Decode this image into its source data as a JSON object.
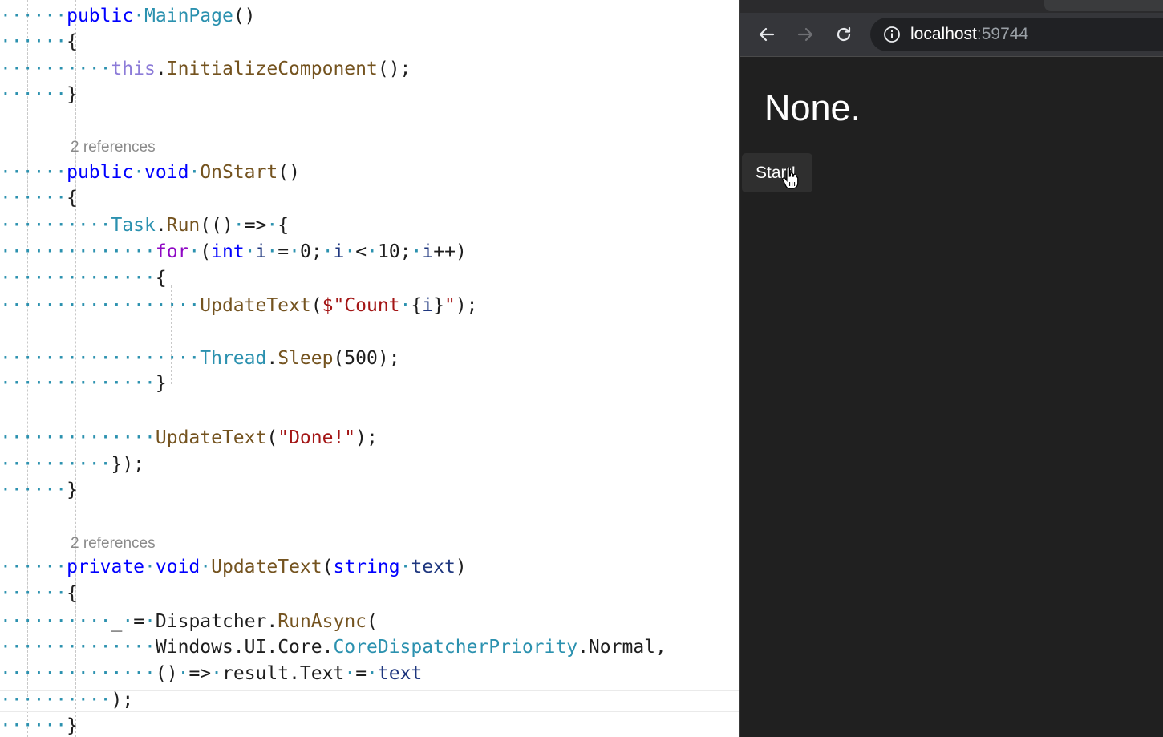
{
  "editor": {
    "lens_1": "2 references",
    "lens_2": "2 references",
    "lines": {
      "l01": "public MainPage()",
      "l02": "{",
      "l03": "this.InitializeComponent();",
      "l04": "}",
      "l05": "public void OnStart()",
      "l06": "{",
      "l07": "Task.Run(() => {",
      "l08": "for (int i = 0; i < 10; i++)",
      "l09": "{",
      "l10": "UpdateText($\"Count {i}\");",
      "l11": "Thread.Sleep(500);",
      "l12": "}",
      "l13": "UpdateText(\"Done!\");",
      "l14": "});",
      "l15": "}",
      "l16": "private void UpdateText(string text)",
      "l17": "{",
      "l18": "_ = Dispatcher.RunAsync(",
      "l19": "Windows.UI.Core.CoreDispatcherPriority.Normal,",
      "l20": "() => result.Text = text",
      "l21": ");",
      "l22": "}"
    }
  },
  "browser": {
    "url_host": "localhost",
    "url_port": ":59744",
    "result_text": "None.",
    "start_button_label": "Start!"
  },
  "colors": {
    "keyword": "#0000ff",
    "control": "#8f08c4",
    "type": "#2b91af",
    "method": "#74531f",
    "string": "#a31515",
    "browser_bg": "#202020"
  }
}
